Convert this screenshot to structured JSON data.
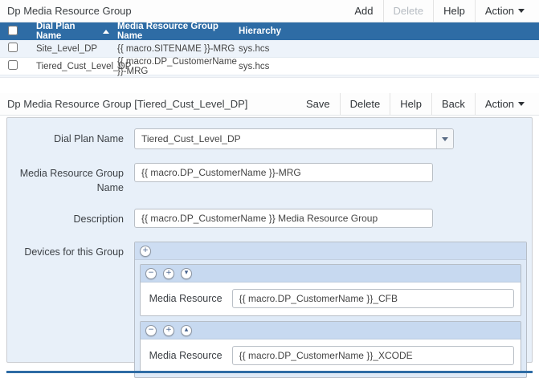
{
  "colors": {
    "header_blue": "#2e6ca5",
    "row_alt_blue": "#edf3fa",
    "form_bg": "#e8f0f9",
    "group_header_bg": "#c7d9f0"
  },
  "icons": {
    "add": "+",
    "remove": "−",
    "move_down": "▾",
    "move_up": "▴"
  },
  "list_panel": {
    "title": "Dp Media Resource Group",
    "toolbar": {
      "add": "Add",
      "delete": "Delete",
      "help": "Help",
      "action": "Action"
    },
    "table": {
      "columns": {
        "dial_plan_name": "Dial Plan Name",
        "mrg_name": "Media Resource Group Name",
        "hierarchy": "Hierarchy"
      },
      "sort": {
        "column": "Dial Plan Name",
        "direction": "ascending"
      },
      "rows": [
        {
          "checked": false,
          "dial_plan_name": "Site_Level_DP",
          "mrg_name": "{{ macro.SITENAME }}-MRG",
          "hierarchy": "sys.hcs"
        },
        {
          "checked": false,
          "dial_plan_name": "Tiered_Cust_Level_DP",
          "mrg_name": "{{ macro.DP_CustomerName }}-MRG",
          "hierarchy": "sys.hcs"
        }
      ]
    }
  },
  "detail_panel": {
    "title": "Dp Media Resource Group [Tiered_Cust_Level_DP]",
    "toolbar": {
      "save": "Save",
      "delete": "Delete",
      "help": "Help",
      "back": "Back",
      "action": "Action"
    },
    "fields": {
      "dial_plan_name": {
        "label": "Dial Plan Name",
        "value": "Tiered_Cust_Level_DP",
        "type": "dropdown"
      },
      "mrg_name": {
        "label": "Media Resource Group Name",
        "value": "{{ macro.DP_CustomerName }}-MRG"
      },
      "description": {
        "label": "Description",
        "value": "{{ macro.DP_CustomerName }} Media Resource Group"
      },
      "devices": {
        "label": "Devices for this Group",
        "items": [
          {
            "label": "Media Resource",
            "value": "{{ macro.DP_CustomerName }}_CFB",
            "controls": [
              "remove",
              "add",
              "move-down"
            ]
          },
          {
            "label": "Media Resource",
            "value": "{{ macro.DP_CustomerName }}_XCODE",
            "controls": [
              "remove",
              "add",
              "move-up"
            ]
          }
        ]
      }
    }
  }
}
